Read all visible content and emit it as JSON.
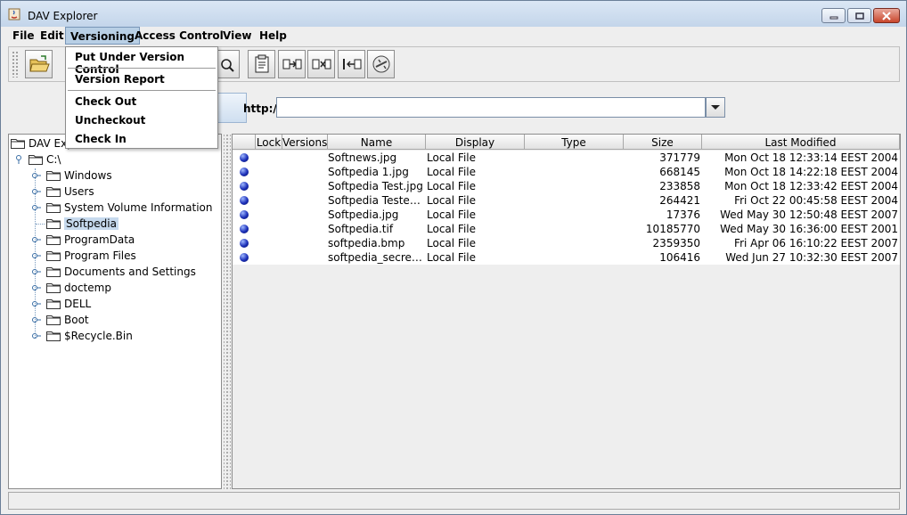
{
  "window": {
    "title": "DAV Explorer"
  },
  "menubar": {
    "items": [
      "File",
      "Edit",
      "Versioning",
      "Access Control",
      "View",
      "Help"
    ],
    "open": "Versioning"
  },
  "versioning_menu": {
    "items": [
      "Put Under Version Control",
      "Version Report",
      "Check Out",
      "Uncheckout",
      "Check In"
    ]
  },
  "toolbar": {
    "buttons": [
      "open-folder-icon",
      "search-file-icon",
      "properties-icon",
      "copy-icon",
      "move-icon",
      "rename-icon",
      "disconnect-icon"
    ]
  },
  "url": {
    "label": "http://",
    "value": ""
  },
  "tree": {
    "root": "DAV Explorer",
    "drive": "C:\\",
    "children": [
      "Windows",
      "Users",
      "System Volume Information",
      "Softpedia",
      "ProgramData",
      "Program Files",
      "Documents and Settings",
      "doctemp",
      "DELL",
      "Boot",
      "$Recycle.Bin"
    ],
    "selected": "Softpedia"
  },
  "table": {
    "columns": [
      "",
      "Lock",
      "Versions",
      "Name",
      "Display",
      "Type",
      "Size",
      "Last Modified"
    ],
    "rows": [
      {
        "name": "Softnews.jpg",
        "display": "Local File",
        "type": "",
        "size": "371779",
        "modified": "Mon Oct 18 12:33:14 EEST 2004"
      },
      {
        "name": "Softpedia 1.jpg",
        "display": "Local File",
        "type": "",
        "size": "668145",
        "modified": "Mon Oct 18 14:22:18 EEST 2004"
      },
      {
        "name": "Softpedia Test.jpg",
        "display": "Local File",
        "type": "",
        "size": "233858",
        "modified": "Mon Oct 18 12:33:42 EEST 2004"
      },
      {
        "name": "Softpedia Tested.j...",
        "display": "Local File",
        "type": "",
        "size": "264421",
        "modified": "Fri Oct 22 00:45:58 EEST 2004"
      },
      {
        "name": "Softpedia.jpg",
        "display": "Local File",
        "type": "",
        "size": "17376",
        "modified": "Wed May 30 12:50:48 EEST 2007"
      },
      {
        "name": "Softpedia.tif",
        "display": "Local File",
        "type": "",
        "size": "10185770",
        "modified": "Wed May 30 16:36:00 EEST 2001"
      },
      {
        "name": "softpedia.bmp",
        "display": "Local File",
        "type": "",
        "size": "2359350",
        "modified": "Fri Apr 06 16:10:22 EEST 2007"
      },
      {
        "name": "softpedia_secret_...",
        "display": "Local File",
        "type": "",
        "size": "106416",
        "modified": "Wed Jun 27 10:32:30 EEST 2007"
      }
    ]
  },
  "status": {
    "text": ""
  }
}
